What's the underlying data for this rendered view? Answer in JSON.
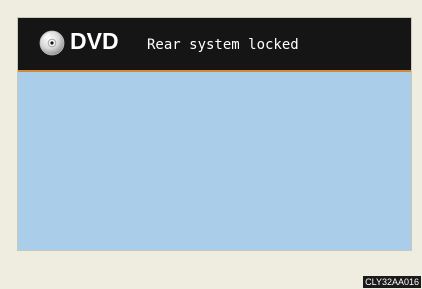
{
  "header": {
    "source_label": "DVD",
    "status_message": "Rear system locked",
    "source_icon": "disc-icon"
  },
  "footer": {
    "image_code": "CLY32AA016"
  },
  "colors": {
    "header_background": "#151515",
    "header_divider": "#d08a3a",
    "screen_background": "#aacdea",
    "page_background": "#efeddf"
  }
}
